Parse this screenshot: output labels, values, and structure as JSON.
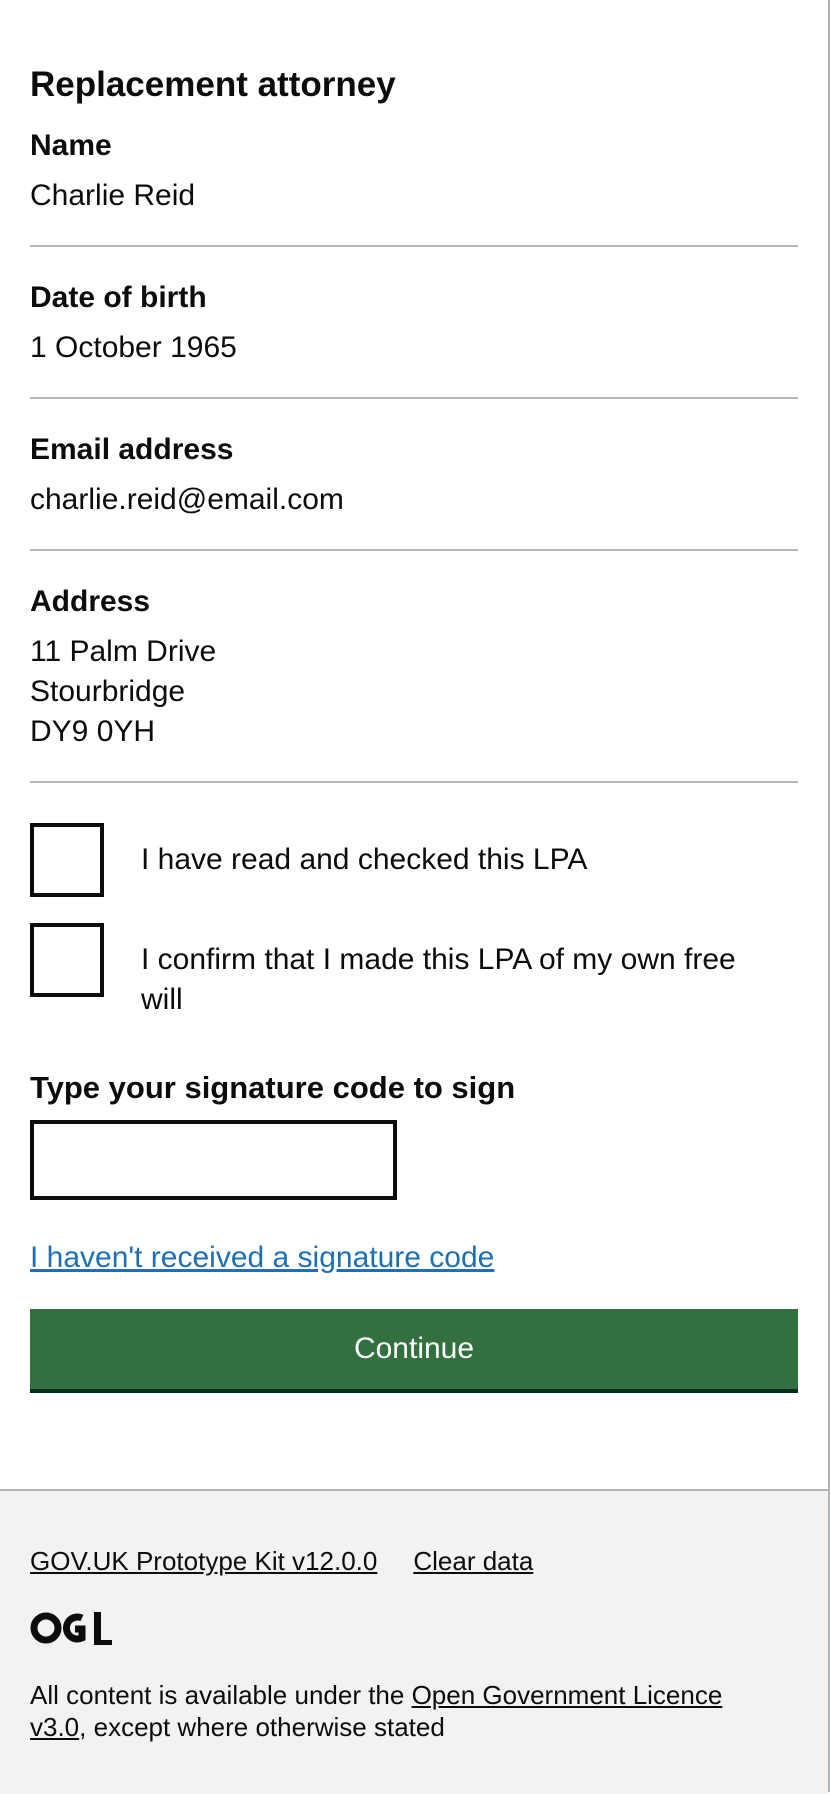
{
  "section": {
    "heading": "Replacement attorney"
  },
  "summary": {
    "name_key": "Name",
    "name_value": "Charlie Reid",
    "dob_key": "Date of birth",
    "dob_value": "1 October 1965",
    "email_key": "Email address",
    "email_value": "charlie.reid@email.com",
    "address_key": "Address",
    "address_lines": [
      "11 Palm Drive",
      "Stourbridge",
      "DY9 0YH"
    ]
  },
  "checkboxes": [
    {
      "label": "I have read and checked this LPA",
      "checked": false
    },
    {
      "label": "I confirm that I made this LPA of my own free will",
      "checked": false
    }
  ],
  "signature": {
    "label": "Type your signature code to sign",
    "value": "",
    "placeholder": ""
  },
  "links": {
    "no_code": "I haven't received a signature code"
  },
  "actions": {
    "continue_label": "Continue"
  },
  "footer": {
    "kit_link": "GOV.UK Prototype Kit v12.0.0",
    "clear_link": "Clear data",
    "logo_text": "OGL",
    "licence_prefix": "All content is available under the ",
    "licence_link": "Open Government Licence v3.0",
    "licence_suffix": ", except where otherwise stated"
  },
  "colors": {
    "link": "#1d70b8",
    "button": "#33703f",
    "footer_bg": "#f3f2f1",
    "rule": "#b1b4b6"
  }
}
